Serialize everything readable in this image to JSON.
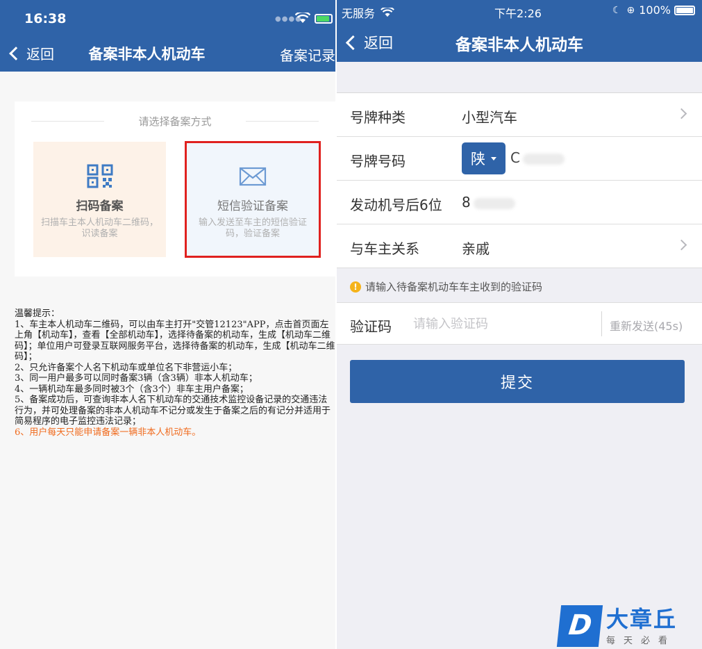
{
  "left_phone": {
    "status_bar": {
      "time": "16:38"
    },
    "nav": {
      "back_label": "返回",
      "title": "备案非本人机动车",
      "records_label": "备案记录"
    },
    "card": {
      "heading": "请选择备案方式",
      "options": [
        {
          "title": "扫码备案",
          "desc": "扫描车主本人机动车二维码，识读备案"
        },
        {
          "title": "短信验证备案",
          "desc": "输入发送至车主的短信验证码，验证备案"
        }
      ]
    },
    "tips": {
      "title": "温馨提示：",
      "lines": [
        "1、车主本人机动车二维码，可以由车主打开\"交管12123\"APP，点击首页面左上角【机动车】，查看【全部机动车】，选择待备案的机动车，生成【机动车二维码】；单位用户可登录互联网服务平台，选择待备案的机动车，生成【机动车二维码】；",
        "2、只允许备案个人名下机动车或单位名下非营运小车；",
        "3、同一用户最多可以同时备案3辆（含3辆）非本人机动车；",
        "4、一辆机动车最多同时被3个（含3个）非车主用户备案；",
        "5、备案成功后，可查询非本人名下机动车的交通技术监控设备记录的交通违法行为，并可处理备案的非本人机动车不记分或发生于备案之后的有记分并适用于简易程序的电子监控违法记录；"
      ],
      "warning": "6、用户每天只能申请备案一辆非本人机动车。"
    }
  },
  "right_phone": {
    "status_bar": {
      "carrier": "无服务",
      "time": "下午2:26",
      "battery": "100%"
    },
    "nav": {
      "back_label": "返回",
      "title": "备案非本人机动车"
    },
    "form": {
      "plate_type_label": "号牌种类",
      "plate_type_value": "小型汽车",
      "plate_number_label": "号牌号码",
      "province": "陕",
      "plate_number_value": "C",
      "engine_label": "发动机号后6位",
      "engine_value": "8",
      "relation_label": "与车主关系",
      "relation_value": "亲戚"
    },
    "hint": "请输入待备案机动车车主收到的验证码",
    "code": {
      "label": "验证码",
      "placeholder": "请输入验证码",
      "resend": "重新发送(45s)"
    },
    "submit_label": "提交",
    "watermark": {
      "brand": "大章丘",
      "slogan": "每天必看",
      "logo_letter": "D"
    }
  },
  "colors": {
    "primary": "#2f63a8",
    "highlight_border": "#e0211f",
    "warning_text": "#f06b1e",
    "hint_icon": "#f5b31a"
  }
}
